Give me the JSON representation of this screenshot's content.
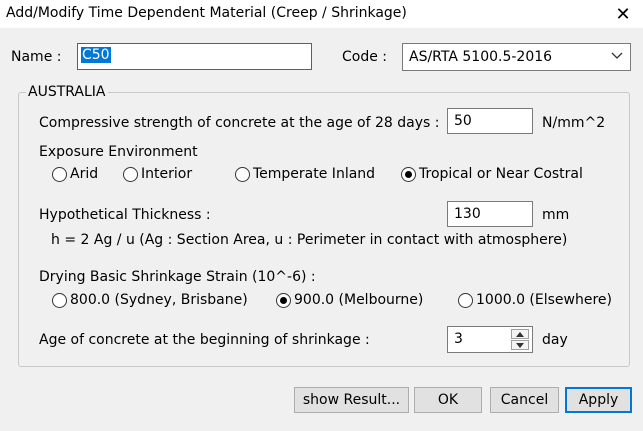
{
  "window": {
    "title": "Add/Modify Time Dependent Material (Creep / Shrinkage)",
    "close_glyph": "✕"
  },
  "name": {
    "label": "Name :",
    "value": "C50"
  },
  "code": {
    "label": "Code :",
    "selected": "AS/RTA 5100.5-2016"
  },
  "group": {
    "title": "AUSTRALIA",
    "compressive": {
      "label": "Compressive strength of concrete at the age of 28 days :",
      "value": "50",
      "unit": "N/mm^2"
    },
    "exposure": {
      "label": "Exposure Environment",
      "options": [
        "Arid",
        "Interior",
        "Temperate Inland",
        "Tropical or Near Costral"
      ],
      "selected_index": 3
    },
    "thickness": {
      "label": "Hypothetical Thickness :",
      "value": "130",
      "unit": "mm",
      "formula": "h = 2 Ag / u (Ag : Section Area, u : Perimeter in contact with atmosphere)"
    },
    "drying": {
      "label": "Drying Basic Shrinkage Strain (10^-6) :",
      "options": [
        "800.0 (Sydney, Brisbane)",
        "900.0 (Melbourne)",
        "1000.0 (Elsewhere)"
      ],
      "selected_index": 1
    },
    "age": {
      "label": "Age of concrete at the beginning of shrinkage :",
      "value": "3",
      "unit": "day"
    }
  },
  "buttons": {
    "show_result": "show Result...",
    "ok": "OK",
    "cancel": "Cancel",
    "apply": "Apply"
  },
  "icons": {
    "combo_arrow": "chevron-down-icon",
    "spin_up": "spin-up-icon",
    "spin_down": "spin-down-icon"
  }
}
